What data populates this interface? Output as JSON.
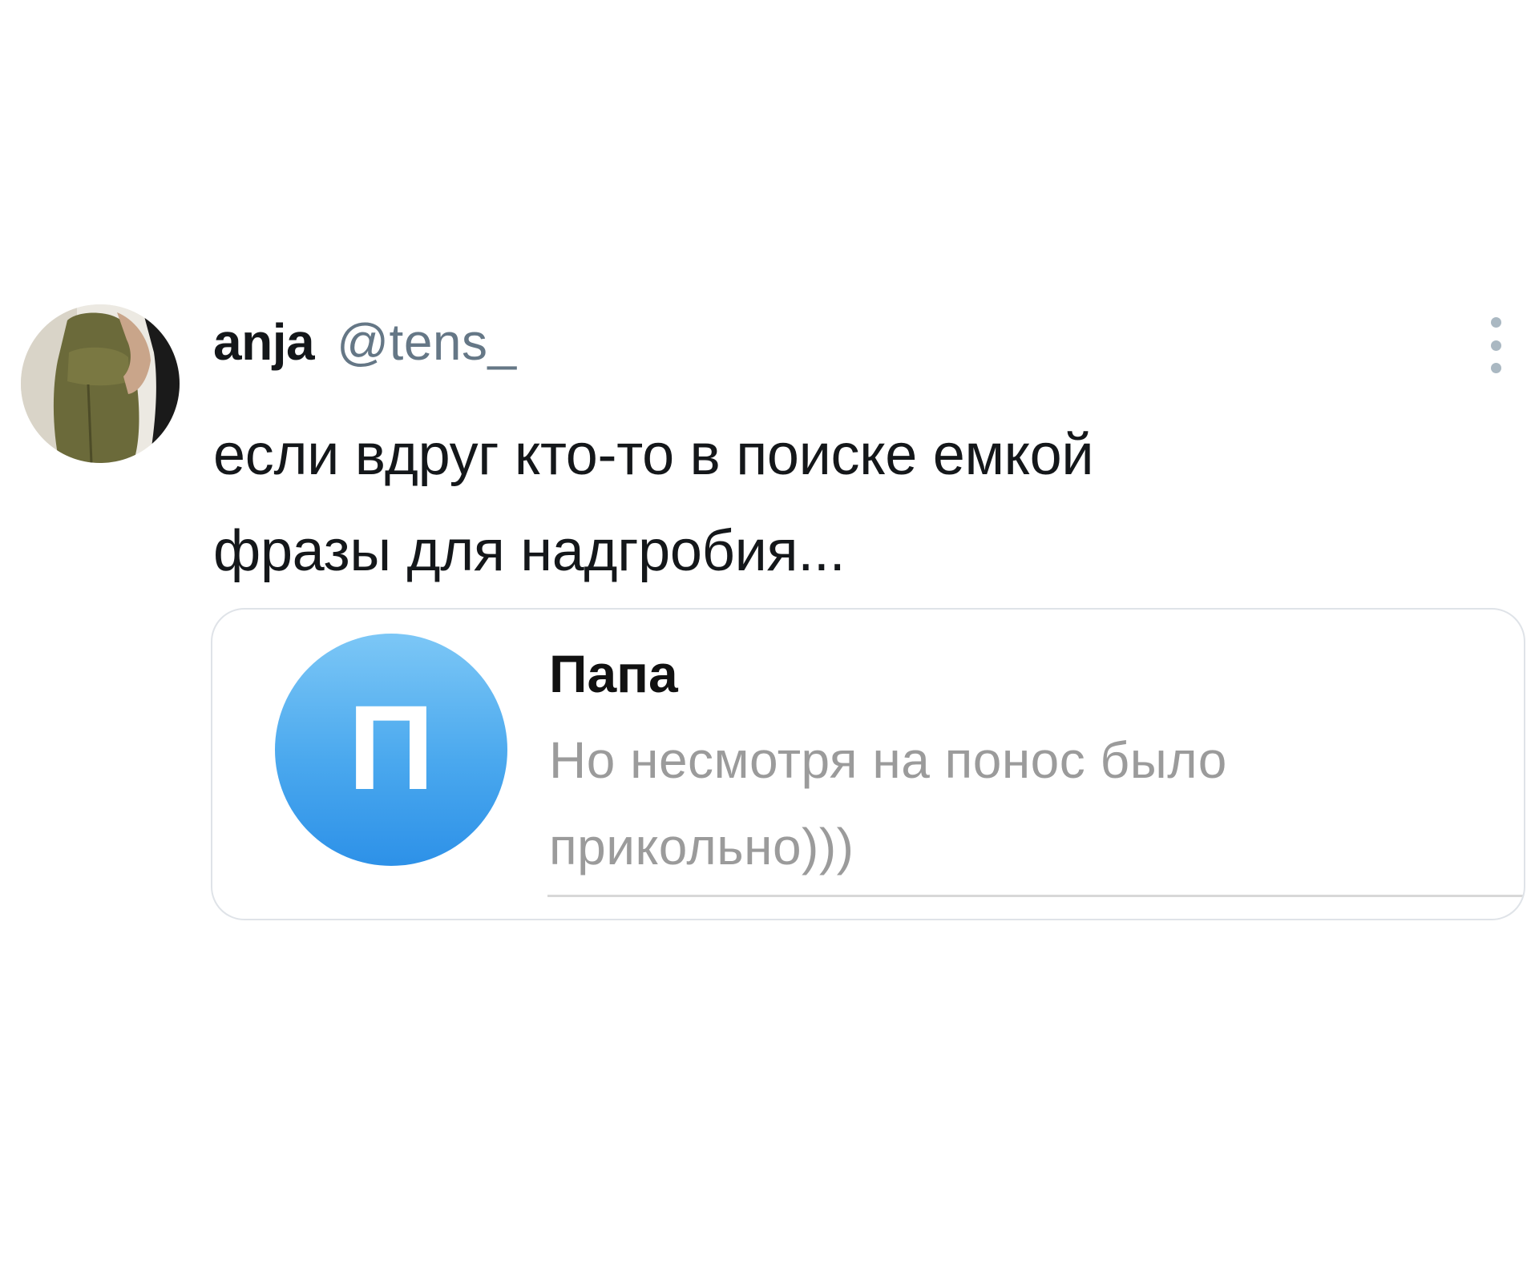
{
  "tweet": {
    "display_name": "anja",
    "handle": "@tens_",
    "text_lines": [
      "если вдруг кто-то в поиске емкой",
      "фразы для надгробия..."
    ],
    "more_icon": "vertical-ellipsis-icon"
  },
  "embedded_chat": {
    "contact_initial": "П",
    "contact_name": "Папа",
    "message_lines": [
      "Но несмотря на понос было",
      "прикольно)))"
    ],
    "avatar_color": "#4aa8ee"
  },
  "colors": {
    "text_primary": "#14171a",
    "text_secondary": "#657786",
    "message_gray": "#9b9b9b",
    "card_border": "#dfe3e8"
  }
}
